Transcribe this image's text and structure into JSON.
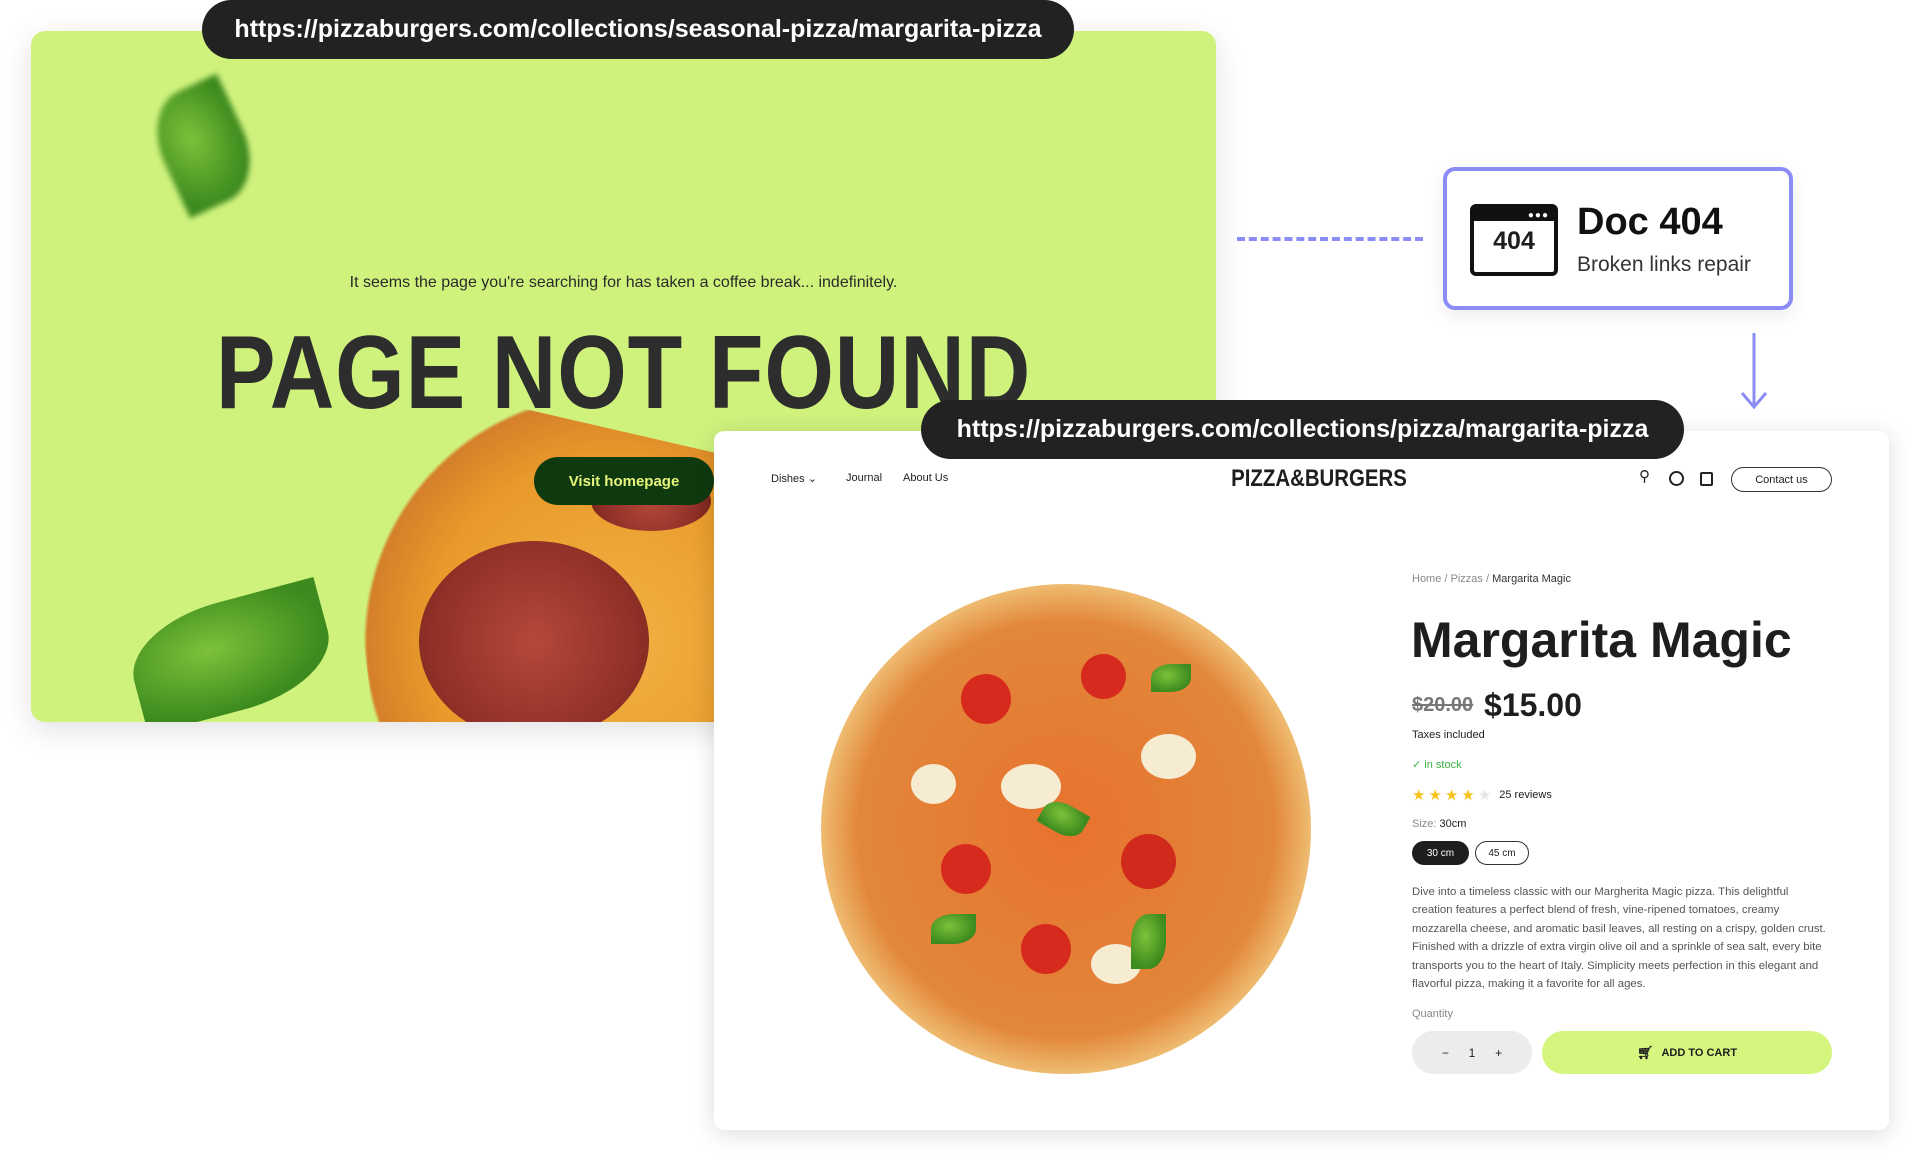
{
  "old_page": {
    "url": "https://pizzaburgers.com/collections/seasonal-pizza/margarita-pizza",
    "subtitle": "It seems the page you're searching for has taken a coffee break... indefinitely.",
    "heading": "PAGE NOT FOUND",
    "button": "Visit homepage",
    "bg_color": "#cff27d"
  },
  "doc404": {
    "icon_text": "404",
    "title": "Doc 404",
    "subtitle": "Broken links repair",
    "border_color": "#8b8cf5"
  },
  "new_page": {
    "url": "https://pizzaburgers.com/collections/pizza/margarita-pizza",
    "nav": {
      "items": [
        "Dishes",
        "Journal",
        "About Us"
      ],
      "logo": "PIZZA&BURGERS",
      "contact": "Contact us"
    },
    "breadcrumb": {
      "home": "Home",
      "sep": "/",
      "category": "Pizzas",
      "current": "Margarita Magic"
    },
    "title": "Margarita Magic",
    "old_price": "$20.00",
    "price": "$15.00",
    "taxes": "Taxes included",
    "stock": "in stock",
    "rating": 4,
    "rating_max": 5,
    "reviews": "25 reviews",
    "size_label": "Size:",
    "size_value": "30cm",
    "sizes": [
      "30 cm",
      "45 cm"
    ],
    "selected_size": "30 cm",
    "description": "Dive into a timeless classic with our Margherita Magic pizza. This delightful creation features a perfect blend of fresh, vine-ripened tomatoes, creamy mozzarella cheese, and aromatic basil leaves, all resting on a crispy, golden crust. Finished with a drizzle of extra virgin olive oil and a sprinkle of sea salt, every bite transports you to the heart of Italy. Simplicity meets perfection in this elegant and flavorful pizza, making it a favorite for all ages.",
    "quantity_label": "Quantity",
    "quantity": "1",
    "add_to_cart": "ADD TO CART",
    "accent": "#d4f57e"
  }
}
